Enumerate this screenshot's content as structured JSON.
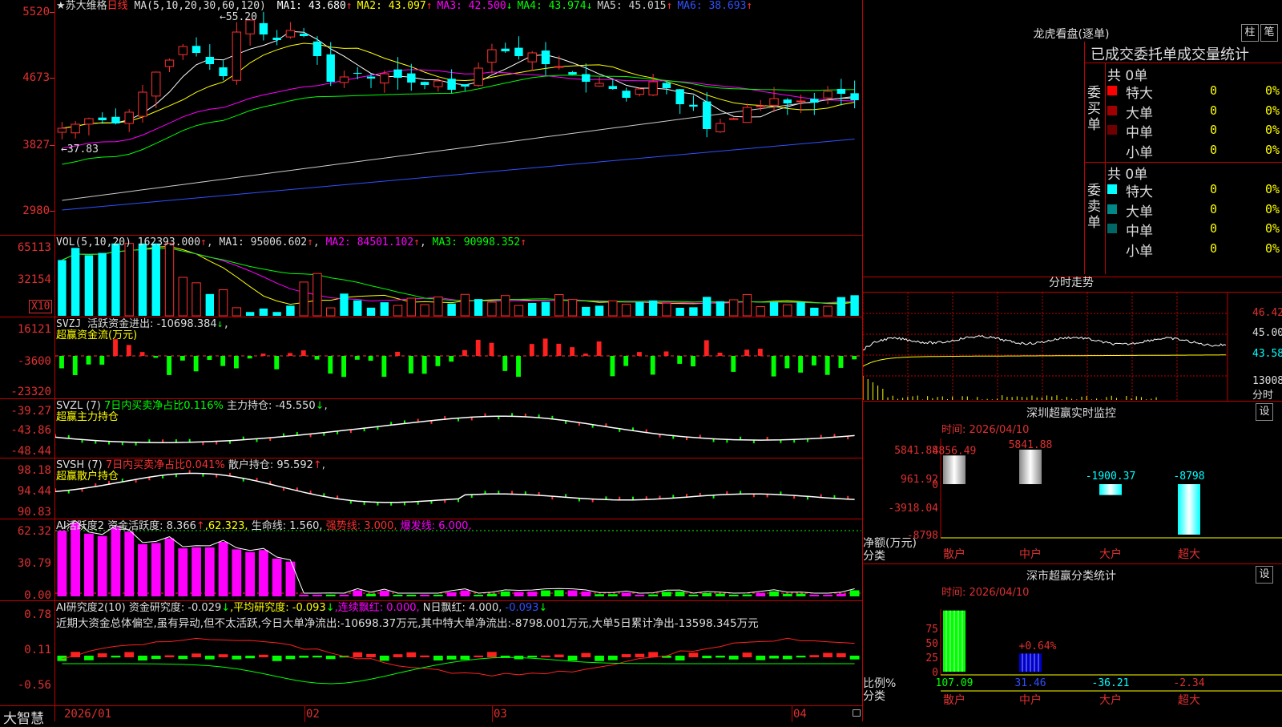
{
  "app": {
    "brand": "大智慧"
  },
  "stock": {
    "title_star": "★苏大维格",
    "period": "日线",
    "ma_label": "MA(5,10,20,30,60,120)",
    "ma": [
      {
        "name": "MA1:",
        "value": "43.680",
        "arrow": "↑",
        "color": "#ffffff"
      },
      {
        "name": "MA2:",
        "value": "43.097",
        "arrow": "↑",
        "color": "#ffff00"
      },
      {
        "name": "MA3:",
        "value": "42.500",
        "arrow": "↓",
        "color": "#ff00ff"
      },
      {
        "name": "MA4:",
        "value": "43.974",
        "arrow": "↓",
        "color": "#00ff00"
      },
      {
        "name": "MA5:",
        "value": "45.015",
        "arrow": "↑",
        "color": "#cccccc"
      },
      {
        "name": "MA6:",
        "value": "38.693",
        "arrow": "↑",
        "color": "#3050ff"
      }
    ],
    "high_marker": "←55.20",
    "low_marker": "←37.83"
  },
  "price_axis": [
    "5520",
    "4673",
    "3827",
    "2980"
  ],
  "vol": {
    "label": "VOL(5,10,20)",
    "value": "162393.000",
    "arrow": "↑",
    "ma1": "MA1: 95006.602",
    "ma1a": "↑",
    "ma2": "MA2: 84501.102",
    "ma2a": "↑",
    "ma3": "MA3: 90998.352",
    "ma3a": "↑",
    "axis": [
      "65113",
      "32154"
    ],
    "unit": "X10"
  },
  "svzj": {
    "label": "SVZJ",
    "desc": "活跃资金进出: -10698.384",
    "arrow": "↓",
    "subtitle": "超赢资金流(万元)",
    "axis": [
      "16121",
      "-3600",
      "-23320"
    ]
  },
  "svzl": {
    "label": "SVZL (7)",
    "desc_green": "7日内买卖净占比0.116%",
    "desc": "主力持仓: -45.550",
    "arrow": "↓",
    "tail": ",",
    "subtitle": "超赢主力持仓",
    "axis": [
      "-39.27",
      "-43.86",
      "-48.44"
    ]
  },
  "svsh": {
    "label": "SVSH (7)",
    "desc_red": "7日内买卖净占比0.041%",
    "desc": "散户持仓: 95.592",
    "arrow": "↑",
    "tail": ",",
    "subtitle": "超赢散户持仓",
    "axis": [
      "98.18",
      "94.44",
      "90.83"
    ]
  },
  "ai1": {
    "label": "AI活跃度2",
    "desc": "资金活跃度: 8.366",
    "arrow": "↑",
    "v2": ",62.323,",
    "v3": "生命线: 1.560,",
    "v4": "强势线: 3.000,",
    "v5": "爆发线: 6.000,",
    "axis": [
      "62.32",
      "30.79",
      "0.00"
    ]
  },
  "ai2": {
    "label": "AI研究度2(10)",
    "desc": "资金研究度: -0.029",
    "arrow": "↓",
    "v2": ",平均研究度: -0.093",
    "a2": "↓",
    "v3": ",连续飘红: 0.000,",
    "v4": "N日飘红: 4.000,",
    "v5": "-0.093",
    "a5": "↓",
    "note": "近期大资金总体偏空,虽有异动,但不太活跃,今日大单净流出:-10698.37万元,其中特大单净流出:-8798.001万元,大单5日累计净出-13598.345万元",
    "axis": [
      "0.78",
      "0.11",
      "-0.56"
    ]
  },
  "xaxis": [
    "2026/01",
    "02",
    "03",
    "04"
  ],
  "dragon": {
    "title": "龙虎看盘(逐单)",
    "btn1": "柱",
    "btn2": "笔",
    "subtitle": "已成交委托单成交量统计",
    "buy_label": "委买单",
    "sell_label": "委卖单",
    "buy_total": "共 0单",
    "sell_total": "共 0单",
    "buy_rows": [
      {
        "name": "特大",
        "num": "0",
        "pct": "0%",
        "color": "#ff0000"
      },
      {
        "name": "大单",
        "num": "0",
        "pct": "0%",
        "color": "#a00000"
      },
      {
        "name": "中单",
        "num": "0",
        "pct": "0%",
        "color": "#700000"
      },
      {
        "name": "小单",
        "num": "0",
        "pct": "0%",
        "color": "#000000"
      }
    ],
    "sell_rows": [
      {
        "name": "特大",
        "num": "0",
        "pct": "0%",
        "color": "#00ffff"
      },
      {
        "name": "大单",
        "num": "0",
        "pct": "0%",
        "color": "#008888"
      },
      {
        "name": "中单",
        "num": "0",
        "pct": "0%",
        "color": "#006666"
      },
      {
        "name": "小单",
        "num": "0",
        "pct": "0%",
        "color": "#000000"
      }
    ]
  },
  "intraday": {
    "title": "分时走势",
    "axis": [
      "46.42",
      "45.00",
      "43.58",
      "13008",
      "分时"
    ]
  },
  "sz_monitor": {
    "title": "深圳超赢实时监控",
    "btn": "设",
    "time": "时间: 2026/04/10",
    "axis": [
      "5841.88",
      "961.92",
      "0",
      "-3918.04",
      "-8798"
    ],
    "unit": "净额(万元)",
    "cat_label": "分类",
    "bars": [
      {
        "cat": "散户",
        "value": "4856.49"
      },
      {
        "cat": "中户",
        "value": "5841.88"
      },
      {
        "cat": "大户",
        "value": "-1900.37"
      },
      {
        "cat": "超大",
        "value": "-8798"
      }
    ]
  },
  "sz_stats": {
    "title": "深市超赢分类统计",
    "btn": "设",
    "time": "时间: 2026/04/10",
    "axis": [
      "75",
      "50",
      "25",
      "0"
    ],
    "unit": "比例%",
    "cat_label": "分类",
    "bars": [
      {
        "cat": "散户",
        "value": "107.09"
      },
      {
        "cat": "中户",
        "value": "31.46"
      },
      {
        "cat": "大户",
        "value": "-36.21"
      },
      {
        "cat": "超大",
        "value": "-2.34"
      }
    ],
    "mid_label": "+0.64%"
  },
  "chart_data": [
    {
      "type": "bar",
      "title": "深圳超赢实时监控",
      "categories": [
        "散户",
        "中户",
        "大户",
        "超大"
      ],
      "values": [
        4856.49,
        5841.88,
        -1900.37,
        -8798
      ],
      "ylabel": "净额(万元)"
    },
    {
      "type": "bar",
      "title": "深市超赢分类统计",
      "categories": [
        "散户",
        "中户",
        "大户",
        "超大"
      ],
      "values": [
        107.09,
        31.46,
        -36.21,
        -2.34
      ],
      "ylabel": "比例%"
    }
  ],
  "colors": {
    "up": "#ff3030",
    "down": "#00ffff",
    "grid": "#c00000",
    "axis_text": "#e03030"
  }
}
